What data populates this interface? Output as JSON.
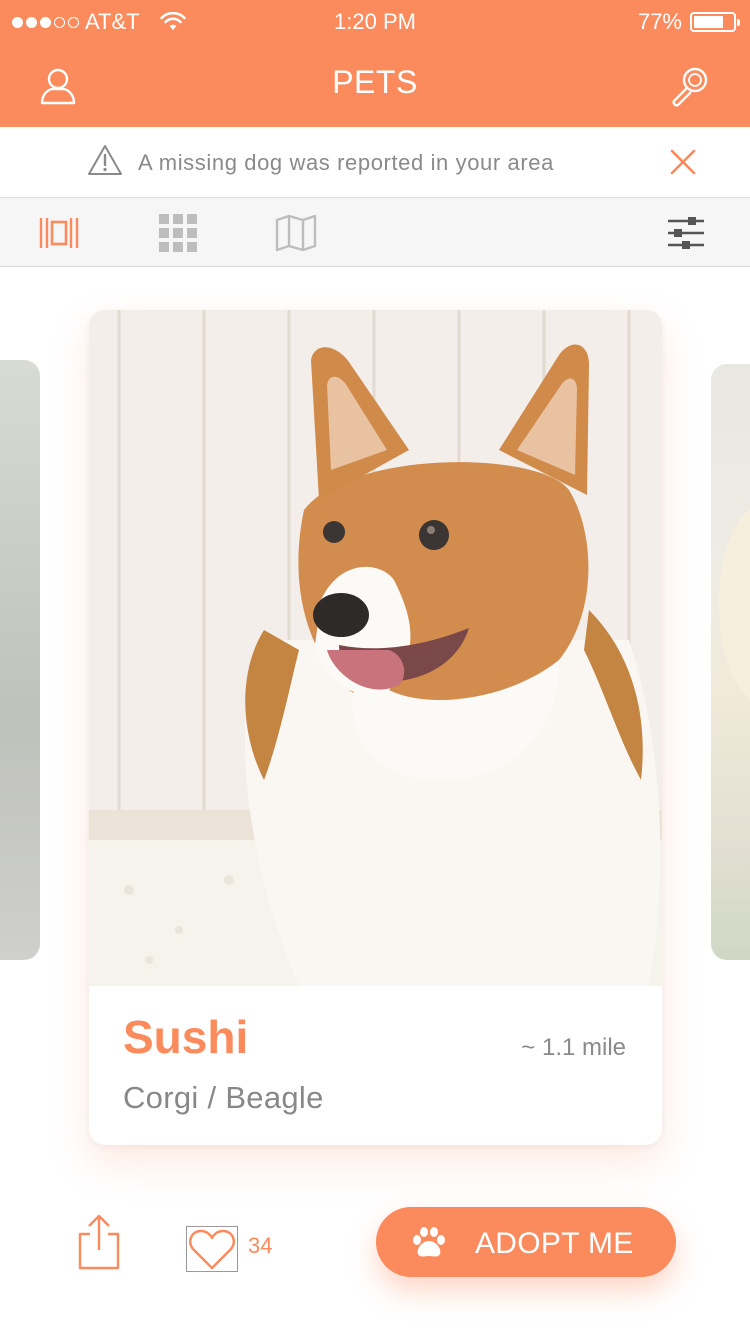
{
  "status_bar": {
    "signal_filled": 3,
    "signal_total": 5,
    "carrier": "AT&T",
    "time": "1:20 PM",
    "battery_percent": 77,
    "battery_label": "77%"
  },
  "nav": {
    "title": "PETS",
    "left_icon": "user-icon",
    "right_icon": "search-icon"
  },
  "alert": {
    "icon": "warning-icon",
    "message": "A missing dog was reported in your area",
    "close_icon": "close-icon"
  },
  "toolbar": {
    "views": [
      {
        "icon": "carousel-view-icon",
        "active": true
      },
      {
        "icon": "grid-view-icon",
        "active": false
      },
      {
        "icon": "map-view-icon",
        "active": false
      }
    ],
    "filter_icon": "filter-sliders-icon"
  },
  "pet": {
    "name": "Sushi",
    "distance": "~ 1.1 mile",
    "breed": "Corgi / Beagle"
  },
  "actions": {
    "share_icon": "share-icon",
    "like_icon": "heart-icon",
    "like_count": "34",
    "adopt_icon": "paw-icon",
    "adopt_label": "ADOPT ME"
  },
  "colors": {
    "accent": "#fb8a5c",
    "muted_text": "#8a8a8a",
    "toolbar_bg": "#f6f6f6"
  }
}
